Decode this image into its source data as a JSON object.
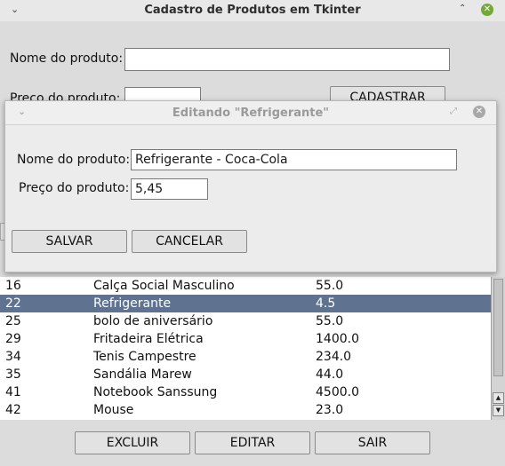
{
  "main_window": {
    "title": "Cadastro de Produtos em Tkinter",
    "menu_icon": "chevron-down-icon",
    "minimize_icon": "caret-up-icon",
    "close_icon": "close-icon",
    "close_color": "#74a93a",
    "name_label": "Nome do produto:",
    "name_value": "",
    "price_label": "Preço do produto:",
    "price_value": "",
    "register_button": "CADASTRAR"
  },
  "dialog": {
    "title": "Editando \"Refrigerante\"",
    "menu_icon": "chevron-down-icon",
    "maximize_icon": "maximize-icon",
    "close_icon": "close-icon",
    "name_label": "Nome do produto:",
    "name_value": "Refrigerante - Coca-Cola",
    "price_label": "Preço do produto:",
    "price_value": "5,45",
    "save_button": "SALVAR",
    "cancel_button": "CANCELAR"
  },
  "products": [
    {
      "id": "16",
      "name": "Calça Social Masculino",
      "price": "55.0",
      "selected": false
    },
    {
      "id": "22",
      "name": "Refrigerante",
      "price": "4.5",
      "selected": true
    },
    {
      "id": "25",
      "name": "bolo de aniversário",
      "price": "55.0",
      "selected": false
    },
    {
      "id": "29",
      "name": "Fritadeira Elétrica",
      "price": "1400.0",
      "selected": false
    },
    {
      "id": "34",
      "name": "Tenis Campestre",
      "price": "234.0",
      "selected": false
    },
    {
      "id": "35",
      "name": "Sandália Marew",
      "price": "44.0",
      "selected": false
    },
    {
      "id": "41",
      "name": "Notebook Sanssung",
      "price": "4500.0",
      "selected": false
    },
    {
      "id": "42",
      "name": "Mouse",
      "price": "23.0",
      "selected": false
    }
  ],
  "bottom_buttons": {
    "delete": "EXCLUIR",
    "edit": "EDITAR",
    "exit": "SAIR"
  },
  "colors": {
    "selection": "#5f7391",
    "window_bg": "#dcdcdc"
  }
}
